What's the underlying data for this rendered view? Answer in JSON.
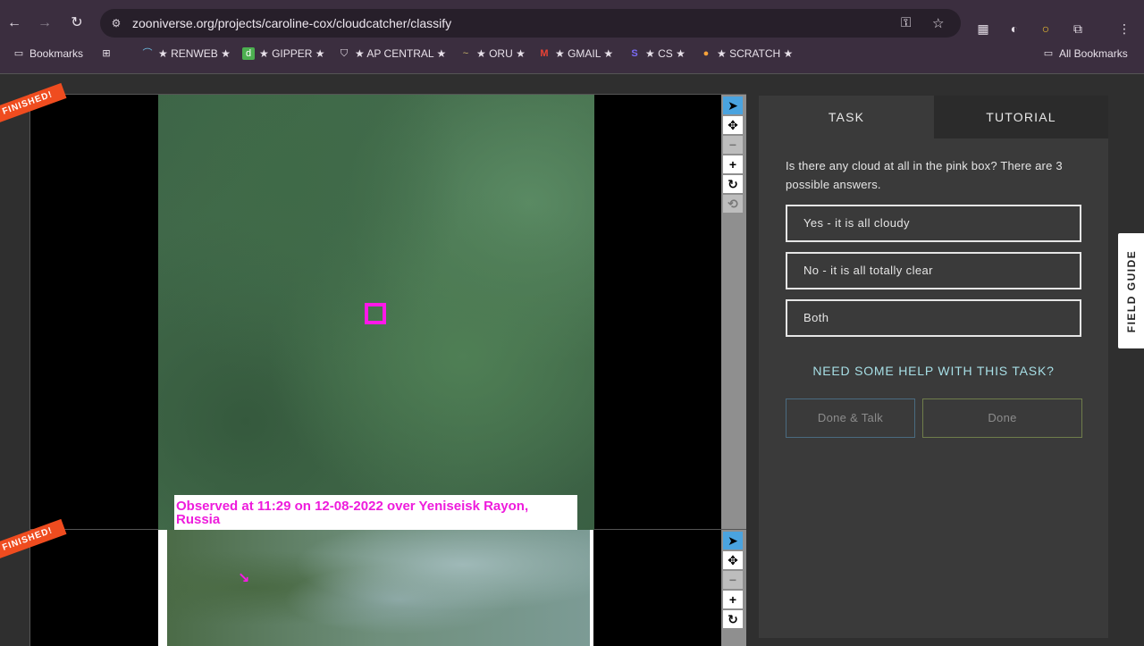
{
  "browser": {
    "url": "zooniverse.org/projects/caroline-cox/cloudcatcher/classify",
    "bookmarks": [
      {
        "label": "Bookmarks",
        "icon": "bookmarks-folder-icon"
      },
      {
        "label": "★ RENWEB ★",
        "icon": "renweb-icon"
      },
      {
        "label": "★ GIPPER ★",
        "icon": "gipper-icon"
      },
      {
        "label": "★ AP CENTRAL ★",
        "icon": "ap-central-icon"
      },
      {
        "label": "★ ORU ★",
        "icon": "oru-icon"
      },
      {
        "label": "★ GMAIL ★",
        "icon": "gmail-icon"
      },
      {
        "label": "★ CS ★",
        "icon": "cs-icon"
      },
      {
        "label": "★ SCRATCH ★",
        "icon": "scratch-icon"
      }
    ],
    "all_bookmarks": "All Bookmarks"
  },
  "subjects": [
    {
      "badge": "FINISHED!",
      "caption": "Observed at 11:29 on 12-08-2022 over Yeniseisk Rayon, Russia"
    },
    {
      "badge": "FINISHED!"
    }
  ],
  "panel": {
    "tabs": {
      "task": "TASK",
      "tutorial": "TUTORIAL"
    },
    "question": "Is there any cloud at all in the pink box? There are 3 possible answers.",
    "answers": [
      "Yes - it is all cloudy",
      "No - it is all totally clear",
      "Both"
    ],
    "help": "NEED SOME HELP WITH THIS TASK?",
    "done_talk": "Done & Talk",
    "done": "Done"
  },
  "field_guide": "FIELD GUIDE",
  "colors": {
    "accent_pink": "#ff18e8",
    "finished_badge": "#ef4c1f",
    "help_text": "#a7dfe6"
  }
}
